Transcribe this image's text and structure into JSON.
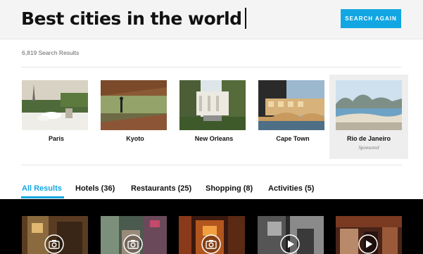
{
  "search": {
    "query": "Best cities in the world",
    "button_label": "SEARCH AGAIN"
  },
  "results": {
    "count_label": "6,819 Search Results"
  },
  "cities": [
    {
      "name": "Paris",
      "sub": ""
    },
    {
      "name": "Kyoto",
      "sub": ""
    },
    {
      "name": "New Orleans",
      "sub": ""
    },
    {
      "name": "Cape Town",
      "sub": ""
    },
    {
      "name": "Rio de Janeiro",
      "sub": "Sponsored"
    }
  ],
  "tabs": [
    {
      "label": "All Results"
    },
    {
      "label": "Hotels (36)"
    },
    {
      "label": "Restaurants (25)"
    },
    {
      "label": "Shopping (8)"
    },
    {
      "label": "Activities (5)"
    }
  ],
  "media": [
    {
      "icon": "camera-icon"
    },
    {
      "icon": "camera-icon"
    },
    {
      "icon": "camera-icon"
    },
    {
      "icon": "play-icon"
    },
    {
      "icon": "play-icon"
    }
  ],
  "colors": {
    "accent": "#12a7e2",
    "sponsored_bg": "#eeeeee",
    "media_bg": "#000000"
  }
}
